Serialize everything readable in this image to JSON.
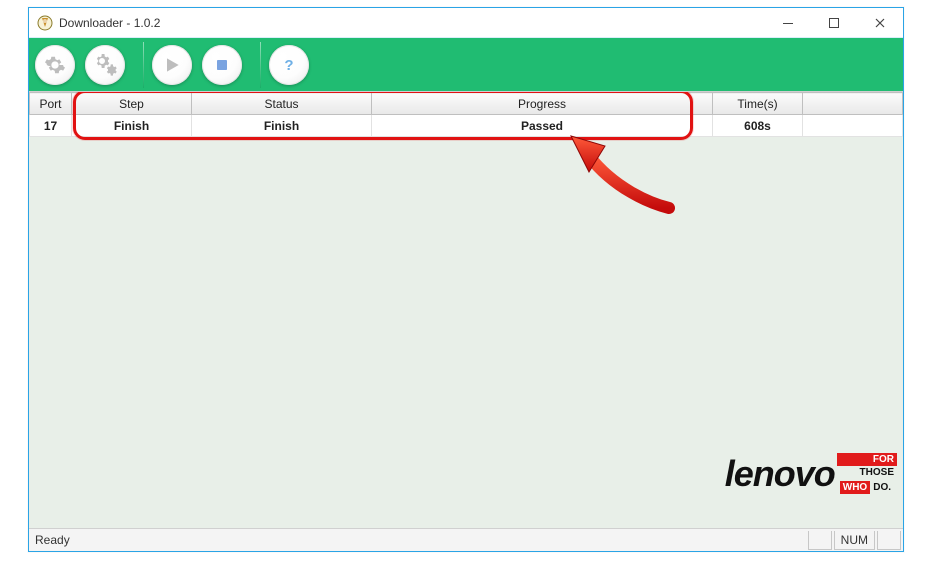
{
  "window": {
    "title": "Downloader - 1.0.2"
  },
  "toolbar": {
    "settings_icon": "settings",
    "settings2_icon": "settings-multi",
    "start_icon": "start",
    "stop_icon": "stop",
    "help_icon": "help"
  },
  "table": {
    "headers": {
      "port": "Port",
      "step": "Step",
      "status": "Status",
      "progress": "Progress",
      "time": "Time(s)",
      "extra": ""
    },
    "rows": [
      {
        "port": "17",
        "step": "Finish",
        "status": "Finish",
        "progress": "Passed",
        "time": "608s"
      }
    ]
  },
  "statusbar": {
    "ready": "Ready",
    "num": "NUM"
  },
  "logo": {
    "brand": "lenovo",
    "tag1": "FOR",
    "tag2": "THOSE",
    "tag3": "WHO",
    "tag4": "DO."
  },
  "colors": {
    "accent": "#20bc72",
    "titlebar_border": "#2aa4e6",
    "pass": "#1aa24a",
    "time": "#1a2ed0",
    "highlight": "#e11212"
  }
}
